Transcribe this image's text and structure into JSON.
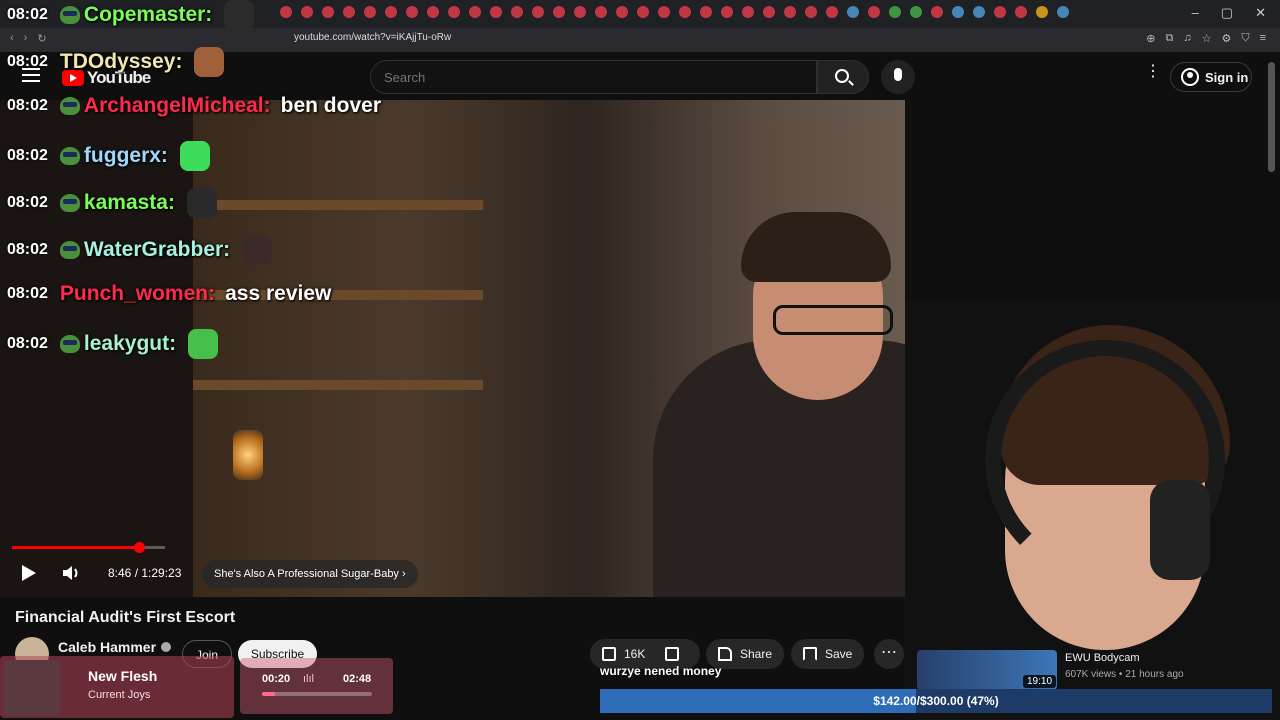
{
  "browser": {
    "url": "youtube.com/watch?v=iKAjjTu-oRw"
  },
  "youtube": {
    "logo_text": "YouTube",
    "search_placeholder": "Search",
    "signin_label": "Sign in"
  },
  "chat": [
    {
      "time": "08:02",
      "user": "Copemaster:",
      "color": "#7cfc5a",
      "text": ""
    },
    {
      "time": "08:02",
      "user": "TDOdyssey:",
      "color": "#f3e6b0",
      "text": ""
    },
    {
      "time": "08:02",
      "user": "ArchangelMicheal:",
      "color": "#ff2a4d",
      "text": "ben dover"
    },
    {
      "time": "08:02",
      "user": "fuggerx:",
      "color": "#9fd7ff",
      "text": ""
    },
    {
      "time": "08:02",
      "user": "kamasta:",
      "color": "#7cfc5a",
      "text": ""
    },
    {
      "time": "08:02",
      "user": "WaterGrabber:",
      "color": "#a8f0e0",
      "text": ""
    },
    {
      "time": "08:02",
      "user": "Punch_women:",
      "color": "#ff2a4d",
      "text": "ass review"
    },
    {
      "time": "08:02",
      "user": "leakygut:",
      "color": "#a8f0d0",
      "text": ""
    }
  ],
  "player": {
    "time_display": "8:46 / 1:29:23",
    "chapter": "She's Also A Professional Sugar-Baby",
    "progress": 0.0987
  },
  "video": {
    "title": "Financial Audit's First Escort",
    "channel": "Caleb Hammer",
    "join_label": "Join",
    "subscribe_label": "Subscribe",
    "likes": "16K",
    "share_label": "Share",
    "save_label": "Save"
  },
  "music": {
    "title": "New Flesh",
    "artist": "Current Joys",
    "current": "00:20",
    "duration": "02:48",
    "progress": 0.12
  },
  "overlay": {
    "subtitle": "wurzye nened money",
    "goal_text": "$142.00/$300.00 (47%)",
    "goal_progress": 0.47
  },
  "recommendation": {
    "title": "EWU Bodycam",
    "meta": "607K views • 21 hours ago",
    "duration": "19:10"
  }
}
